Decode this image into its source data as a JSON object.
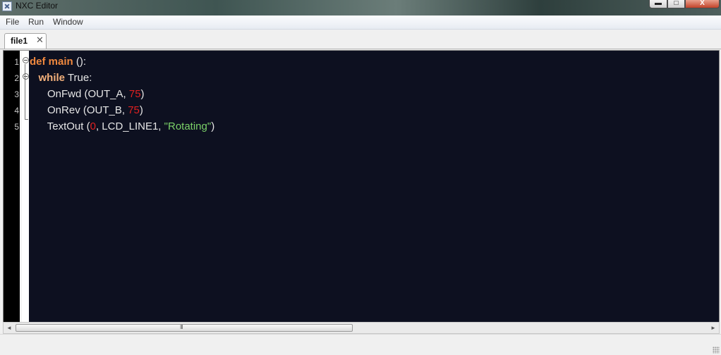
{
  "window": {
    "title": "NXC Editor",
    "minimize_glyph": "▬",
    "maximize_glyph": "□",
    "close_glyph": "X"
  },
  "menu": {
    "items": [
      "File",
      "Run",
      "Window"
    ]
  },
  "tabs": [
    {
      "label": "file1",
      "close_glyph": "✕"
    }
  ],
  "editor": {
    "line_numbers": [
      "1",
      "2",
      "3",
      "4",
      "5"
    ],
    "lines": [
      [
        {
          "t": "def",
          "c": "kw"
        },
        {
          "t": " "
        },
        {
          "t": "main",
          "c": "kw"
        },
        {
          "t": " ():"
        }
      ],
      [
        {
          "t": "   "
        },
        {
          "t": "while",
          "c": "kw2"
        },
        {
          "t": " True:"
        }
      ],
      [
        {
          "t": "      OnFwd (OUT_A, "
        },
        {
          "t": "75",
          "c": "num"
        },
        {
          "t": ")"
        }
      ],
      [
        {
          "t": "      OnRev (OUT_B, "
        },
        {
          "t": "75",
          "c": "num"
        },
        {
          "t": ")"
        }
      ],
      [
        {
          "t": "      TextOut ("
        },
        {
          "t": "0",
          "c": "num"
        },
        {
          "t": ", LCD_LINE1, "
        },
        {
          "t": "\"Rotating\"",
          "c": "str"
        },
        {
          "t": ")"
        }
      ]
    ]
  },
  "scrollbar": {
    "left_arrow": "◄",
    "right_arrow": "►",
    "grip": "III"
  },
  "colors": {
    "editor_background": "#0d1020",
    "keyword": "#f0883e",
    "number": "#e02020",
    "string": "#7bd168",
    "plain_text": "#e6e6e6"
  }
}
